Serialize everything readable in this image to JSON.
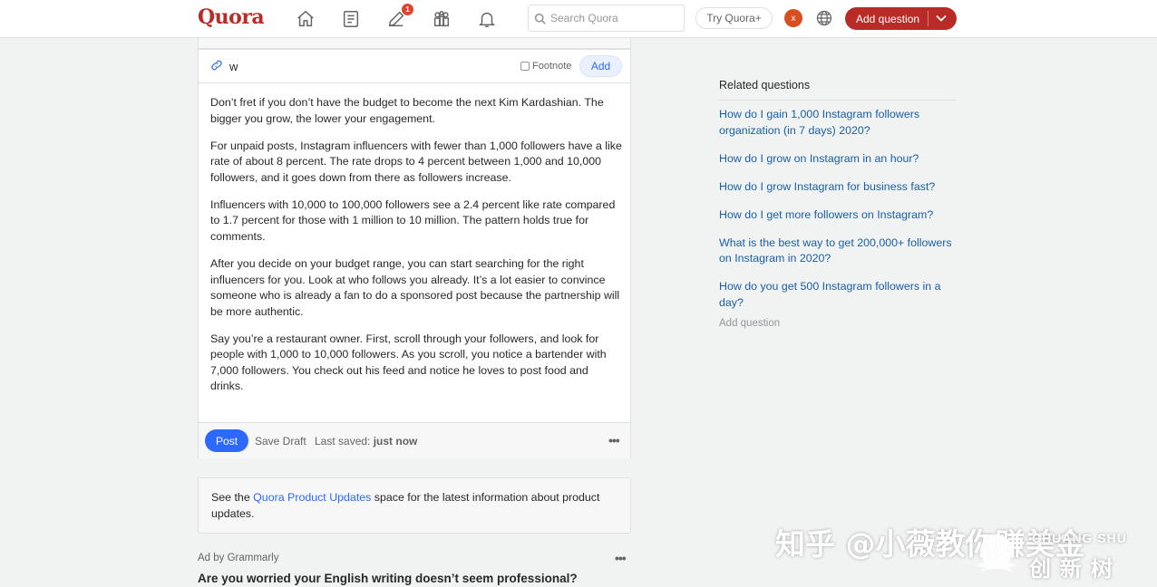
{
  "header": {
    "logo": "Quora",
    "notification_count": "1",
    "search_placeholder": "Search Quora",
    "try_label": "Try Quora+",
    "avatar_initial": "x",
    "add_question_label": "Add question",
    "brand_color": "#b92b27"
  },
  "editor": {
    "link_text": "w",
    "footnote_label": "Footnote",
    "add_label": "Add",
    "paragraphs": [
      "Don’t fret if you don’t have the budget to become the next Kim Kardashian. The bigger you grow, the lower your engagement.",
      "For unpaid posts, Instagram influencers with fewer than 1,000 followers have a like rate of about 8 percent. The rate drops to 4 percent between 1,000 and 10,000 followers, and it goes down from there as followers increase.",
      "Influencers with 10,000 to 100,000 followers see a 2.4 percent like rate compared to 1.7 percent for those with 1 million to 10 million. The pattern holds true for comments.",
      "After you decide on your budget range, you can start searching for the right influencers for you. Look at who follows you already. It’s a lot easier to convince someone who is already a fan to do a sponsored post because the partnership will be more authentic.",
      "Say you’re a restaurant owner. First, scroll through your followers, and look for people with 1,000 to 10,000 followers. As you scroll, you notice a bartender with 7,000 followers. You check out his feed and notice he loves to post food and drinks."
    ],
    "post_label": "Post",
    "save_draft_label": "Save Draft",
    "last_saved_prefix": "Last saved:",
    "last_saved_value": "just now",
    "more_label": "•••"
  },
  "updates": {
    "prefix": "See the ",
    "link": "Quora Product Updates",
    "suffix": " space for the latest information about product updates."
  },
  "ad": {
    "by": "Ad by Grammarly",
    "more_label": "•••",
    "title": "Are you worried your English writing doesn’t seem professional?"
  },
  "related": {
    "title": "Related questions",
    "items": [
      "How do I gain 1,000 Instagram followers organization (in 7 days) 2020?",
      "How do I grow on Instagram in an hour?",
      "How do I grow Instagram for business fast?",
      "How do I get more followers on Instagram?",
      "What is the best way to get 200,000+ followers on Instagram in 2020?",
      "How do you get 500 Instagram followers in a day?"
    ],
    "add_label": "Add question"
  },
  "watermark": {
    "main": "知乎 @小薇教你赚美金",
    "sub1": "CHUANG SHU",
    "sub2": "创新树"
  }
}
